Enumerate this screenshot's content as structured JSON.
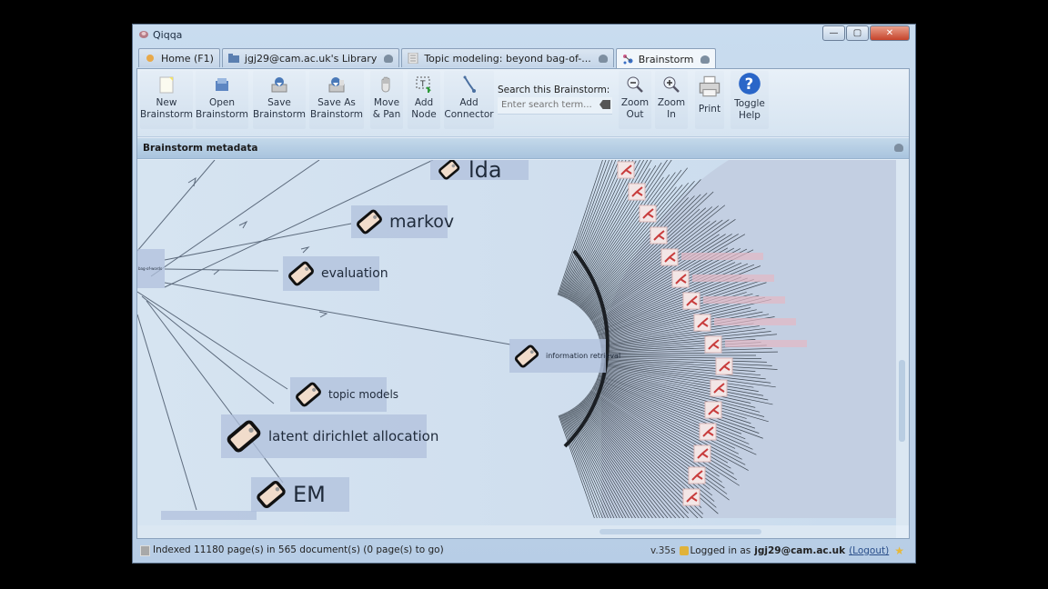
{
  "window": {
    "title": "Qiqqa"
  },
  "window_controls": {
    "minimize": "—",
    "maximize": "▢",
    "close": "✕"
  },
  "tabs": [
    {
      "label": "Home (F1)",
      "icon": "home-icon",
      "active": false
    },
    {
      "label": "jgj29@cam.ac.uk's Library",
      "icon": "folder-icon",
      "active": false
    },
    {
      "label": "Topic modeling: beyond bag-of-...",
      "icon": "document-icon",
      "active": false
    },
    {
      "label": "Brainstorm",
      "icon": "brainstorm-icon",
      "active": true
    }
  ],
  "toolbar": {
    "new": [
      "New",
      "Brainstorm"
    ],
    "open": [
      "Open",
      "Brainstorm"
    ],
    "save": [
      "Save",
      "Brainstorm"
    ],
    "save_as": [
      "Save As",
      "Brainstorm"
    ],
    "move_pan": [
      "Move",
      "& Pan"
    ],
    "add_node": [
      "Add",
      "Node"
    ],
    "add_connector": [
      "Add",
      "Connector"
    ],
    "search_label": "Search this Brainstorm:",
    "search_placeholder": "Enter search term...",
    "search_value": "",
    "zoom_out": [
      "Zoom",
      "Out"
    ],
    "zoom_in": [
      "Zoom",
      "In"
    ],
    "print": "Print",
    "toggle_help": [
      "Toggle",
      "Help"
    ]
  },
  "metadata_panel": {
    "title": "Brainstorm metadata"
  },
  "brainstorm": {
    "center_node": "bag-of-words",
    "nodes": [
      {
        "label": "lda"
      },
      {
        "label": "markov"
      },
      {
        "label": "evaluation"
      },
      {
        "label": "information retrieval"
      },
      {
        "label": "topic models"
      },
      {
        "label": "latent dirichlet allocation"
      },
      {
        "label": "EM"
      }
    ]
  },
  "status": {
    "indexing": "Indexed 11180 page(s) in 565 document(s) (0 page(s) to go)",
    "version": "v.35s",
    "logged_in_prefix": "Logged in as",
    "user": "jgj29@cam.ac.uk",
    "logout": "(Logout)"
  },
  "colors": {
    "accent": "#c6432a",
    "help_blue": "#2a66c8",
    "pdf_red": "#c83c3c"
  }
}
